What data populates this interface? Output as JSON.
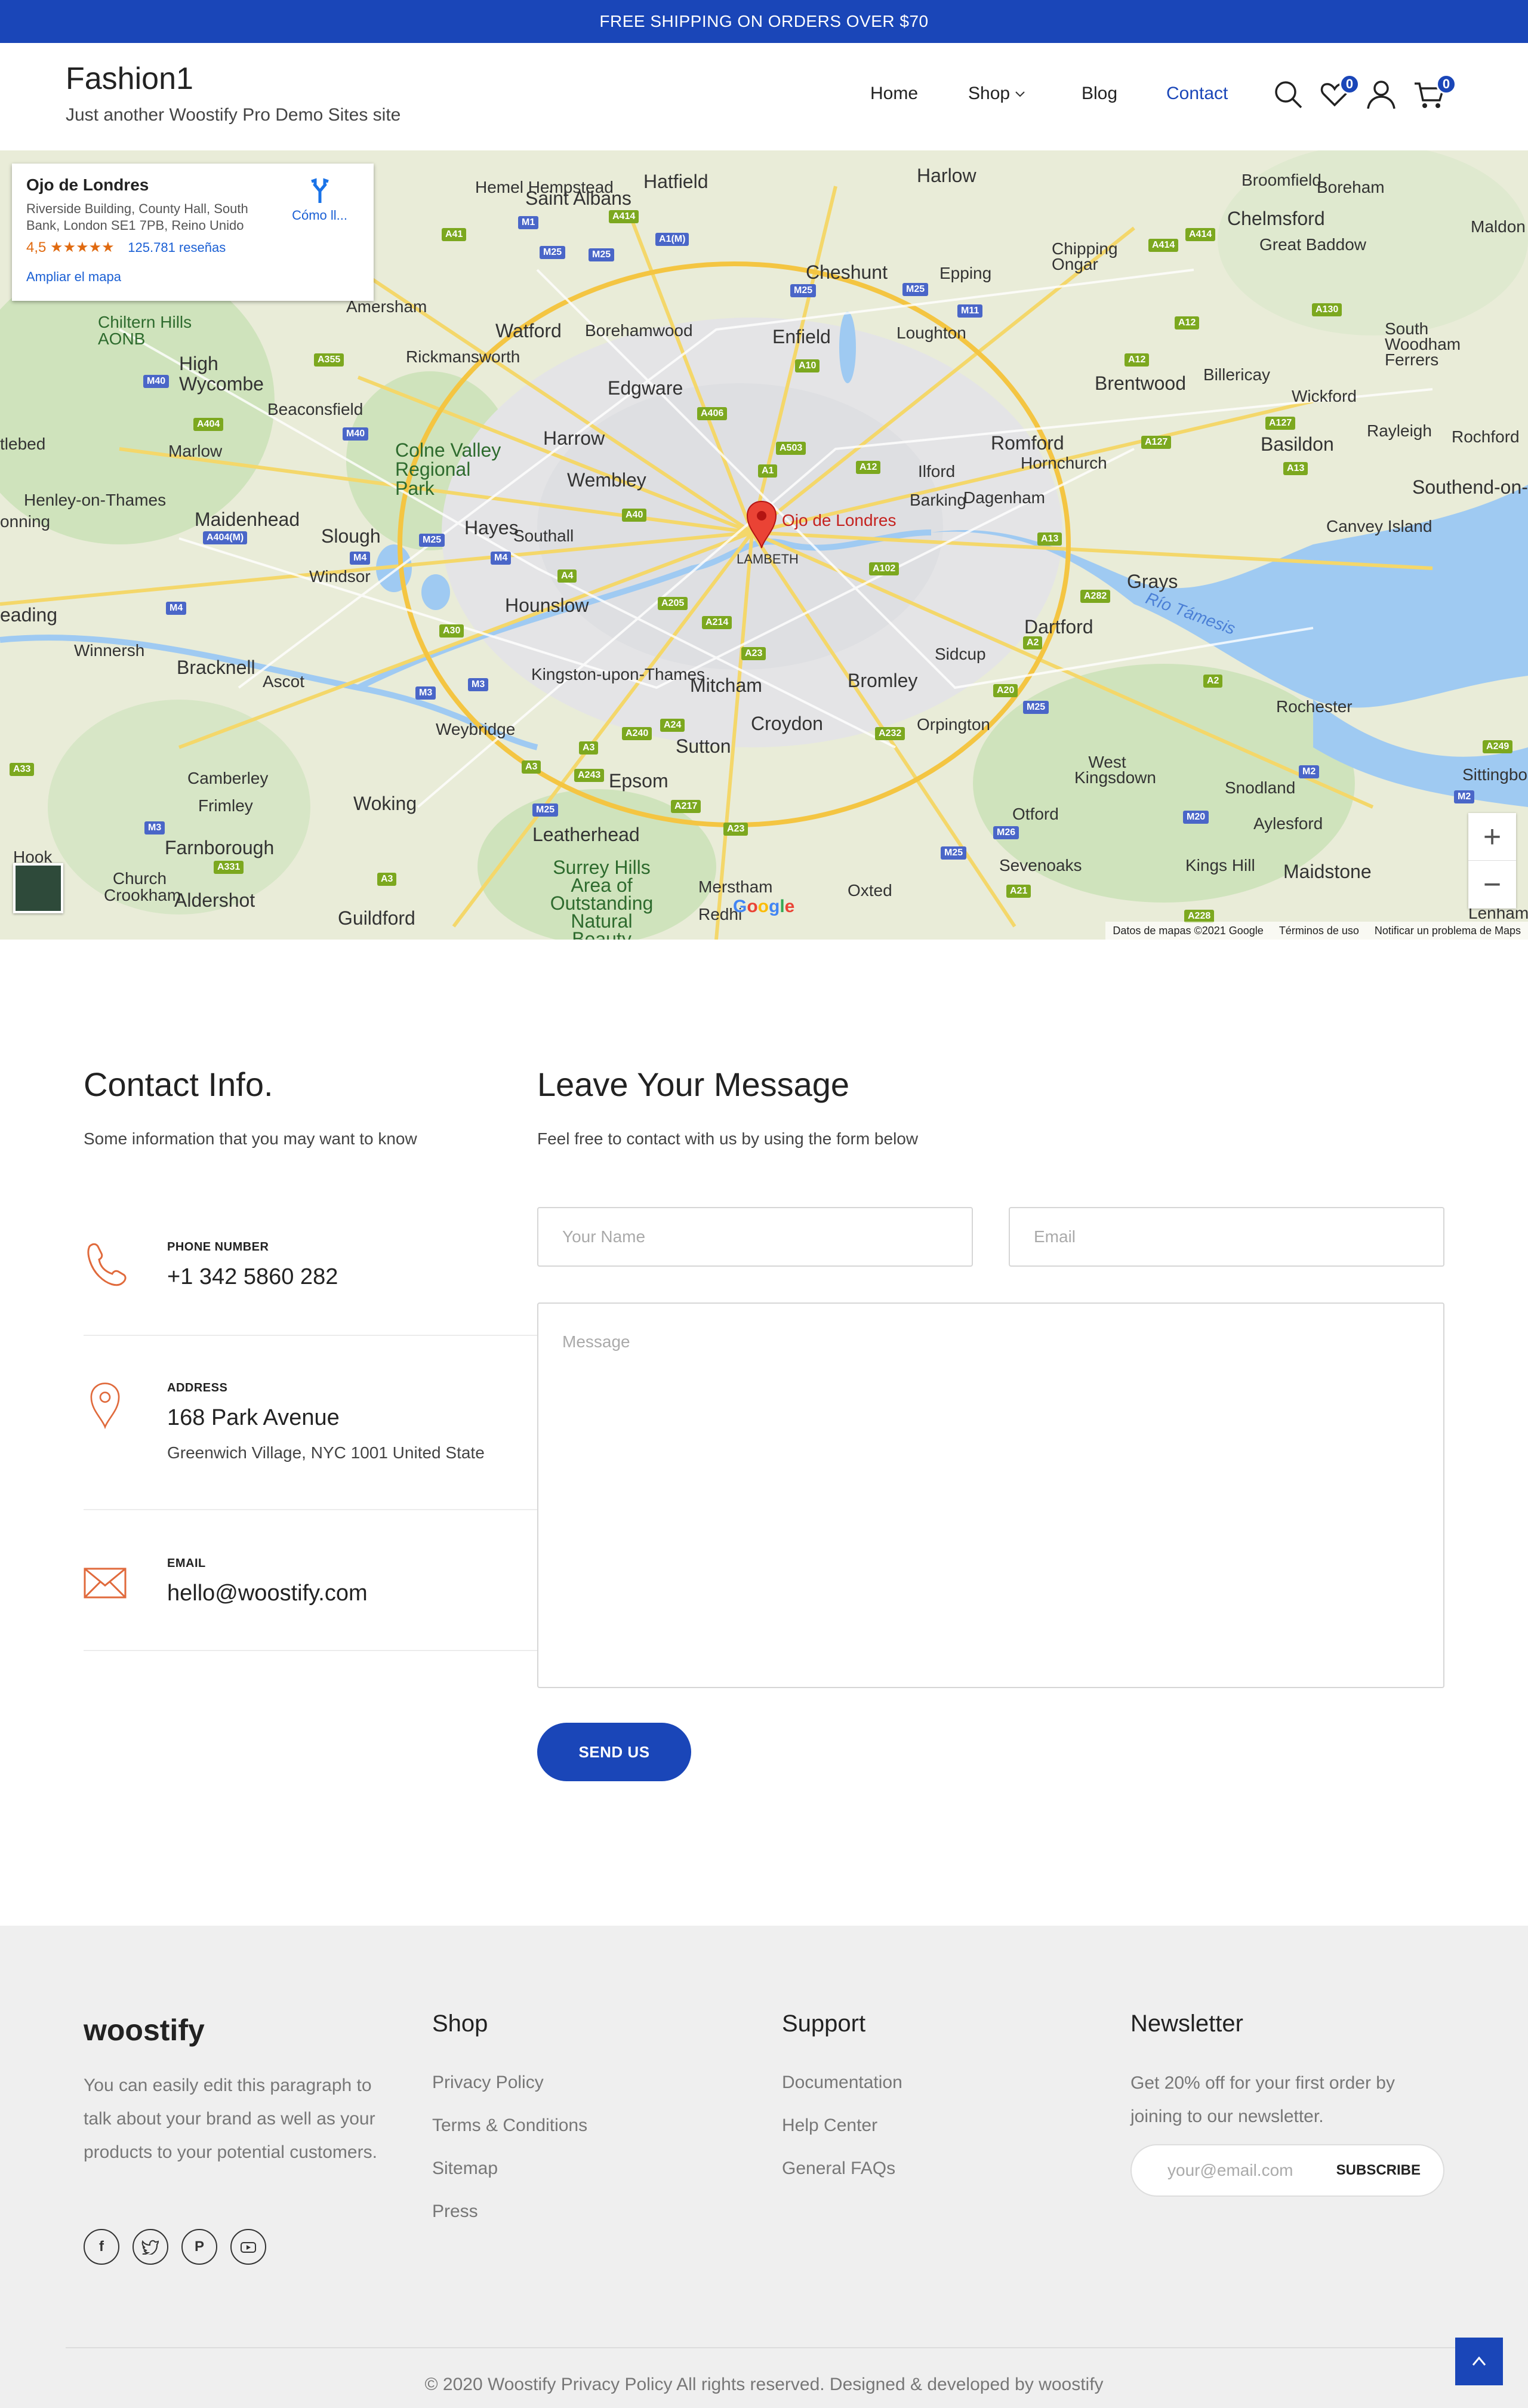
{
  "topbar": {
    "text": "FREE SHIPPING ON ORDERS OVER $70"
  },
  "header": {
    "site_name": "Fashion1",
    "tagline": "Just another Woostify Pro Demo Sites site",
    "nav": {
      "home": "Home",
      "shop": "Shop",
      "blog": "Blog",
      "contact": "Contact"
    },
    "wishlist_count": "0",
    "cart_count": "0",
    "accent": "#1a46b8"
  },
  "map": {
    "card": {
      "title": "Ojo de Londres",
      "address": "Riverside Building, County Hall, South Bank, London SE1 7PB, Reino Unido",
      "rating": "4,5",
      "stars": "★★★★★",
      "reviews": "125.781 reseñas",
      "directions": "Cómo ll...",
      "enlarge": "Ampliar el mapa"
    },
    "pin_label": "Ojo de Londres",
    "footer": {
      "data": "Datos de mapas ©2021 Google",
      "terms": "Términos de uso",
      "report": "Notificar un problema de Maps"
    },
    "places": {
      "hemel": "Hemel Hempstead",
      "stalbans": "Saint Albans",
      "hatfield": "Hatfield",
      "harlow": "Harlow",
      "broomfield": "Broomfield",
      "boreham": "Boreham",
      "chelmsford": "Chelmsford",
      "greatbaddow": "Great Baddow",
      "maldon": "Maldon",
      "cheshunt": "Cheshunt",
      "epping": "Epping",
      "chippingongar": "Chipping Ongar",
      "southwoodham": "South Woodham Ferrers",
      "watford": "Watford",
      "borehamwood": "Borehamwood",
      "enfield": "Enfield",
      "loughton": "Loughton",
      "brentwood": "Brentwood",
      "billericay": "Billericay",
      "wickford": "Wickford",
      "highwycombe": "High Wycombe",
      "chilterns": "Chiltern Hills AONB",
      "rickmansworth": "Rickmansworth",
      "edgware": "Edgware",
      "beaconsfield": "Beaconsfield",
      "harrow": "Harrow",
      "romford": "Romford",
      "hornchurch": "Hornchurch",
      "basildon": "Basildon",
      "rayleigh": "Rayleigh",
      "rochford": "Rochford",
      "southend": "Southend-on-S",
      "marlow": "Marlow",
      "colnevalley": "Colne Valley Regional Park",
      "wembley": "Wembley",
      "ilford": "Ilford",
      "barking": "Barking",
      "dagenham": "Dagenham",
      "henley": "Henley-on-Thames",
      "maidenhead": "Maidenhead",
      "slough": "Slough",
      "hayes": "Hayes",
      "southall": "Southall",
      "lambeth": "LAMBETH",
      "canvey": "Canvey Island",
      "windsor": "Windsor",
      "grays": "Grays",
      "reading": "eading",
      "hounslow": "Hounslow",
      "dartford": "Dartford",
      "riotamesis": "Río Támesis",
      "winnersh": "Winnersh",
      "bracknell": "Bracknell",
      "ascot": "Ascot",
      "kingston": "Kingston-upon-Thames",
      "mitcham": "Mitcham",
      "bromley": "Bromley",
      "sidcup": "Sidcup",
      "rochester": "Rochester",
      "weybridge": "Weybridge",
      "croydon": "Croydon",
      "orpington": "Orpington",
      "sutton": "Sutton",
      "westkingsdown": "West Kingsdown",
      "camberley": "Camberley",
      "frimley": "Frimley",
      "woking": "Woking",
      "epsom": "Epsom",
      "snodland": "Snodland",
      "leatherhead": "Leatherhead",
      "otford": "Otford",
      "aylesford": "Aylesford",
      "farnborough": "Farnborough",
      "surreyhills": "Surrey Hills Area of Outstanding Natural Beauty",
      "sevenoaks": "Sevenoaks",
      "kingshill": "Kings Hill",
      "maidstone": "Maidstone",
      "hook": "Hook",
      "churchcrookham": "Church Crookham",
      "aldershot": "Aldershot",
      "guildford": "Guildford",
      "merstham": "Merstham",
      "redhill": "Redhi",
      "oxted": "Oxted",
      "lenham": "Lenham",
      "sittingbourne": "Sittingbou",
      "amersham": "Amersham",
      "lebed": "tlebed",
      "onning": "onning"
    },
    "roads": {
      "a41": "A41",
      "m1": "M1",
      "m25a": "M25",
      "m25b": "M25",
      "a414a": "A414",
      "a1m": "A1(M)",
      "a414b": "A414",
      "a414c": "A414",
      "m25c": "M25",
      "m25d": "M25",
      "m11": "M11",
      "a130": "A130",
      "a355": "A355",
      "a12a": "A12",
      "m40a": "M40",
      "a10": "A10",
      "a12b": "A12",
      "a406": "A406",
      "a404": "A404",
      "m40b": "M40",
      "a503": "A503",
      "a127a": "A127",
      "a127b": "A127",
      "a1": "A1",
      "a12c": "A12",
      "a13a": "A13",
      "a404m": "A404(M)",
      "a40": "A40",
      "m25e": "M25",
      "a13b": "A13",
      "m4a": "M4",
      "m4b": "M4",
      "a4": "A4",
      "a102": "A102",
      "a282": "A282",
      "m4c": "M4",
      "a205": "A205",
      "a214": "A214",
      "a30": "A30",
      "a2a": "A2",
      "m3a": "M3",
      "a23a": "A23",
      "a2b": "A2",
      "a20": "A20",
      "m25f": "M25",
      "a33": "A33",
      "a3a": "A3",
      "a240": "A240",
      "a232": "A232",
      "a24": "A24",
      "a243": "A243",
      "m2a": "M2",
      "m2b": "M2",
      "a249": "A249",
      "a3b": "A3",
      "m25g": "M25",
      "a217": "A217",
      "a23b": "A23",
      "m3b": "M3",
      "m26": "M26",
      "m20": "M20",
      "a331": "A331",
      "a3c": "A3",
      "m25h": "M25",
      "a21": "A21",
      "a228": "A228"
    }
  },
  "contact_info": {
    "title": "Contact Info.",
    "subtitle": "Some information that you may want to know",
    "phone_label": "PHONE NUMBER",
    "phone": "+1 342 5860 282",
    "address_label": "ADDRESS",
    "address": "168 Park Avenue",
    "address2": "Greenwich Village, NYC 1001 United State",
    "email_label": "EMAIL",
    "email": "hello@woostify.com",
    "icon_color": "#e06a3c"
  },
  "message_form": {
    "title": "Leave Your Message",
    "subtitle": "Feel free to contact with us by using the form below",
    "name_placeholder": "Your Name",
    "email_placeholder": "Email",
    "message_placeholder": "Message",
    "send": "SEND US"
  },
  "footer": {
    "logo": "woostify",
    "description": "You can easily edit this paragraph to talk about your brand as well as your products to your potential customers.",
    "shop_title": "Shop",
    "shop_links": [
      "Privacy Policy",
      "Terms & Conditions",
      "Sitemap",
      "Press"
    ],
    "support_title": "Support",
    "support_links": [
      "Documentation",
      "Help Center",
      "General FAQs"
    ],
    "newsletter_title": "Newsletter",
    "newsletter_desc": "Get 20% off for your first order by joining to our newsletter.",
    "newsletter_placeholder": "your@email.com",
    "subscribe": "SUBSCRIBE",
    "copyright": "© 2020 Woostify Privacy Policy All rights reserved. Designed & developed by woostify",
    "socials": [
      "facebook-icon",
      "twitter-icon",
      "pinterest-icon",
      "youtube-icon"
    ]
  }
}
